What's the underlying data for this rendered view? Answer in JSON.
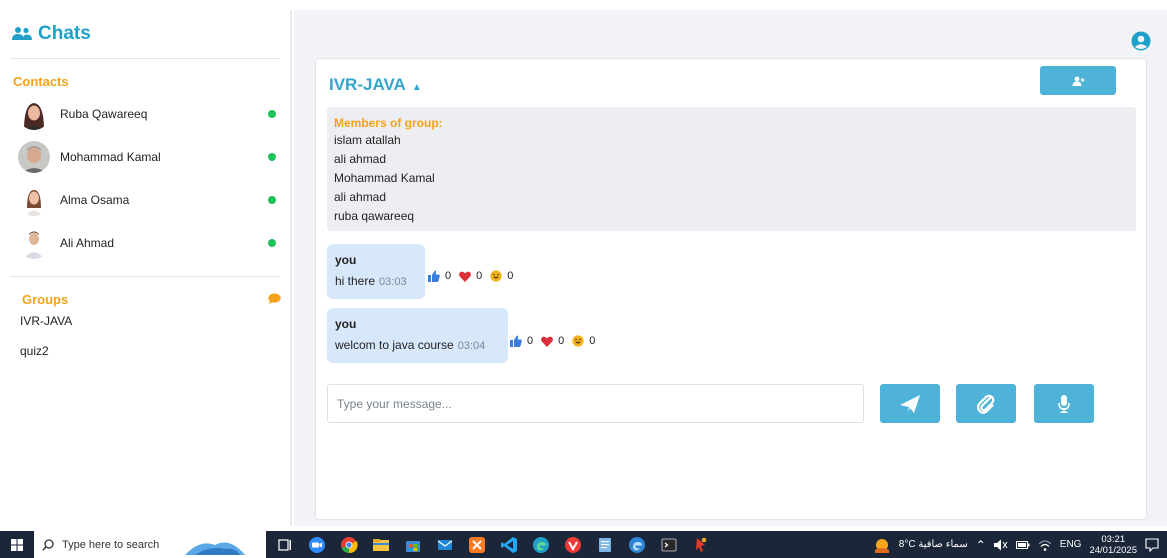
{
  "sidebar": {
    "title": "Chats",
    "contacts_label": "Contacts",
    "contacts": [
      {
        "name": "Ruba Qawareeq",
        "status": "online"
      },
      {
        "name": "Mohammad Kamal",
        "status": "online"
      },
      {
        "name": "Alma Osama",
        "status": "online"
      },
      {
        "name": "Ali Ahmad",
        "status": "online"
      }
    ],
    "groups_label": "Groups",
    "groups": [
      "IVR-JAVA",
      "quiz2"
    ]
  },
  "chat": {
    "group_name": "IVR-JAVA",
    "caret": "▲",
    "members_heading": "Members of group:",
    "members": [
      "islam atallah",
      "ali ahmad",
      "Mohammad Kamal",
      "ali ahmad",
      "ruba qawareeq"
    ],
    "messages": [
      {
        "author": "you",
        "text": "hi there",
        "time": "03:03",
        "likes": "0",
        "hearts": "0",
        "laughs": "0"
      },
      {
        "author": "you",
        "text": "welcom to java course",
        "time": "03:04",
        "likes": "0",
        "hearts": "0",
        "laughs": "0"
      }
    ],
    "composer_placeholder": "Type your message..."
  },
  "taskbar": {
    "search_placeholder": "Type here to search",
    "weather": "8°C سماء صافية",
    "language": "ENG",
    "time": "03:21",
    "date": "24/01/2025"
  },
  "colors": {
    "accent": "#4fb3d9",
    "title_blue": "#35a4cf",
    "orange": "#f5a21b",
    "online": "#1ec15a",
    "bubble": "#d8e8fb"
  }
}
